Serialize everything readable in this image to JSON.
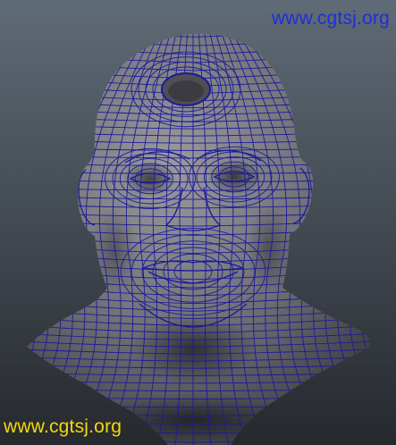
{
  "watermarks": {
    "top": "www.cgtsj.org",
    "bottom": "www.cgtsj.org"
  },
  "colors": {
    "background_top": "#5f6b76",
    "background_bottom": "#26292e",
    "mesh_wire": "#1c1a9a",
    "skin_light": "#9a9a9e",
    "skin_dark": "#3d3d43",
    "watermark_top": "#1f2fd8",
    "watermark_bottom": "#f2d80a"
  },
  "icons": {
    "subject": "wireframe-head-bust-icon"
  }
}
